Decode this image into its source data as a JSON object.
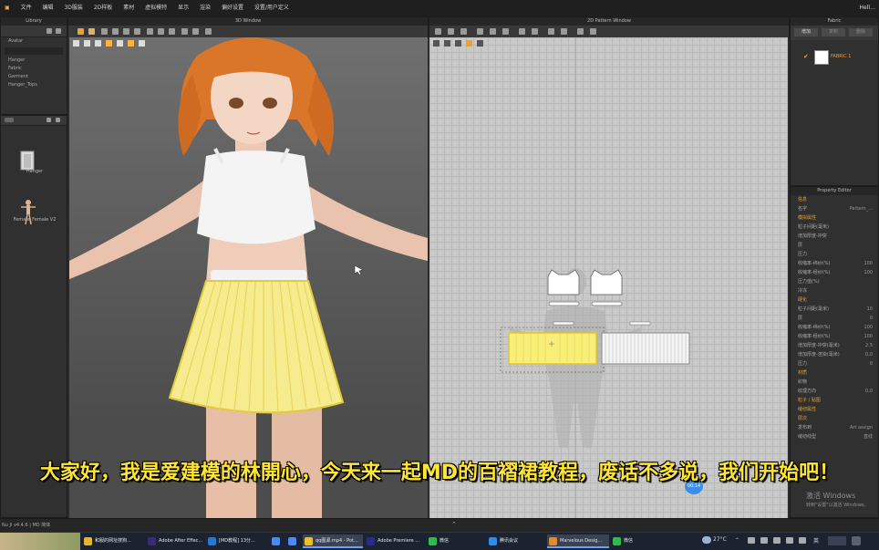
{
  "menu": {
    "items": [
      "文件",
      "编辑",
      "3D服装",
      "2D样板",
      "素材",
      "虚拟模特",
      "显示",
      "渲染",
      "偏好设置",
      "设置/用户定义"
    ],
    "user": "Hell…"
  },
  "panels": {
    "library_title": "Library",
    "library_items": [
      "Avatar",
      "Hanger",
      "Fabric",
      "Garment",
      "Hanger_Tops"
    ],
    "asset_labels": [
      "Hanger",
      "Female_Female V2"
    ],
    "view3d_title": "3D Window",
    "view2d_title": "2D Pattern Window",
    "object_browser_title": "Fabric",
    "object_browser_tabs": [
      "增加",
      "复制",
      "删除"
    ],
    "fabric_name": "FABRIC 1",
    "property_title": "Property Editor",
    "property_rows": [
      {
        "label": "信息",
        "value": "",
        "section": true
      },
      {
        "label": "名字",
        "value": "Pattern_...",
        "section": false
      },
      {
        "label": "模拟属性",
        "value": "",
        "section": true
      },
      {
        "label": "粒子间距(毫米)",
        "value": "",
        "section": false
      },
      {
        "label": "增加厚度-冲突",
        "value": "",
        "section": false
      },
      {
        "label": "层",
        "value": "",
        "section": false
      },
      {
        "label": "压力",
        "value": "",
        "section": false
      },
      {
        "label": "收缩率-纬纱(%)",
        "value": "100",
        "section": false
      },
      {
        "label": "收缩率-经纱(%)",
        "value": "100",
        "section": false
      },
      {
        "label": "压力值(%)",
        "value": "",
        "section": false
      },
      {
        "label": "冷冻",
        "value": "",
        "section": false
      },
      {
        "label": "硬化",
        "value": "",
        "section": true
      },
      {
        "label": "粒子间距(毫米)",
        "value": "10",
        "section": false
      },
      {
        "label": "层",
        "value": "0",
        "section": false
      },
      {
        "label": "收缩率-纬纱(%)",
        "value": "100",
        "section": false
      },
      {
        "label": "收缩率-经纱(%)",
        "value": "100",
        "section": false
      },
      {
        "label": "增加厚度-冲突(毫米)",
        "value": "2.5",
        "section": false
      },
      {
        "label": "增加厚度-渲染(毫米)",
        "value": "0.0",
        "section": false
      },
      {
        "label": "压力",
        "value": "0",
        "section": false
      },
      {
        "label": "材质",
        "value": "",
        "section": true
      },
      {
        "label": "织物",
        "value": "",
        "section": false
      },
      {
        "label": "纹理方向",
        "value": "0.0",
        "section": false
      },
      {
        "label": "粒子 / 贴图",
        "value": "",
        "section": true
      },
      {
        "label": "缝纫属性",
        "value": "",
        "section": true
      },
      {
        "label": "层次",
        "value": "",
        "section": true
      },
      {
        "label": "发布到",
        "value": "Art assign",
        "section": false
      },
      {
        "label": "缝纫线型",
        "value": "直线",
        "section": false
      }
    ]
  },
  "subtitle": "大家好，我是爱建模的林開心，今天来一起MD的百褶裙教程，废话不多说，我们开始吧！",
  "watermark": {
    "line1": "激活 Windows",
    "line2": "转到\"设置\"以激活 Windows。"
  },
  "bubble": "00:14",
  "statusbar": {
    "left": "Nu Ji v4.4.6 | MD 简体"
  },
  "taskbar": {
    "items": [
      {
        "label": "和服的网址搜狗...",
        "color": "#e9b52c",
        "active": false
      },
      {
        "label": "Adobe After Effec...",
        "color": "#3a2a7a",
        "active": false
      },
      {
        "label": "[MD教程] 13分...",
        "color": "#1f7bd6",
        "active": false
      },
      {
        "label": "",
        "color": "#4a8af4",
        "active": false
      },
      {
        "label": "",
        "color": "#4a8af4",
        "active": false
      },
      {
        "label": "qq图源.mp4 - Pot...",
        "color": "#f0c020",
        "active": true
      },
      {
        "label": "Adobe Premiere ...",
        "color": "#2a2a8a",
        "active": false
      },
      {
        "label": "微信",
        "color": "#2cbd4c",
        "active": false
      },
      {
        "label": "腾讯会议",
        "color": "#2c8cf0",
        "active": false
      },
      {
        "label": "Marvelous Desig...",
        "color": "#e48b2a",
        "active": true
      },
      {
        "label": "微信",
        "color": "#2cbd4c",
        "active": false
      }
    ],
    "weather": "27°C",
    "ime": "英"
  }
}
